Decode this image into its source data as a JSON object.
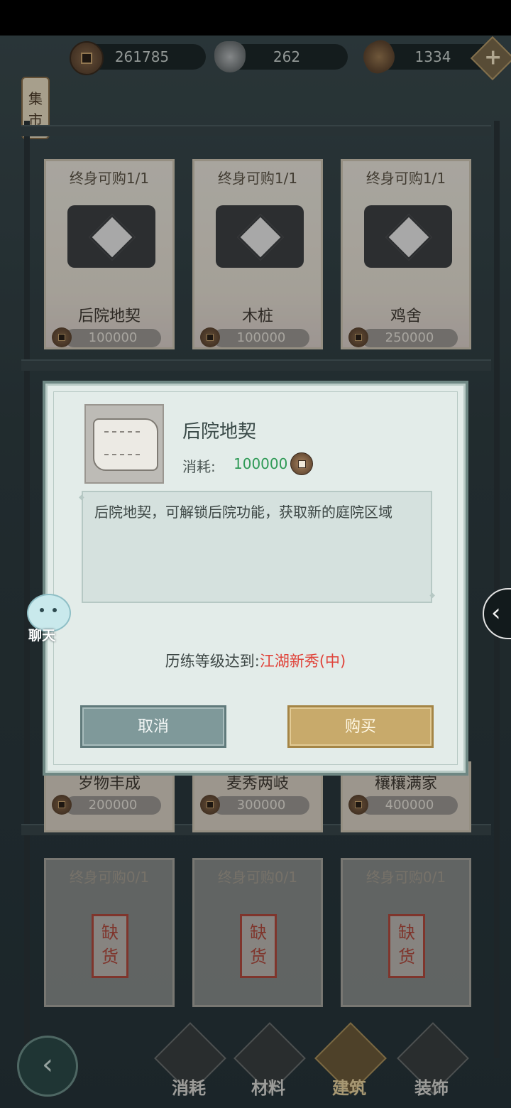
{
  "currencies": [
    {
      "icon": "copper-coin-icon",
      "value": "261785"
    },
    {
      "icon": "silver-ingot-icon",
      "value": "262"
    },
    {
      "icon": "seed-icon",
      "value": "1334"
    }
  ],
  "add_currency_icon": "plus-icon",
  "market_tag": "集市",
  "shelf_items": [
    {
      "limit": "终身可购1/1",
      "name": "后院地契",
      "price": "100000"
    },
    {
      "limit": "终身可购1/1",
      "name": "木桩",
      "price": "100000"
    },
    {
      "limit": "终身可购1/1",
      "name": "鸡舍",
      "price": "250000"
    }
  ],
  "shelf_items_row3": [
    {
      "name": "岁物丰成",
      "price": "200000"
    },
    {
      "name": "麦秀两岐",
      "price": "300000"
    },
    {
      "name": "穰穰满家",
      "price": "400000"
    }
  ],
  "shelf_items_soldout": [
    {
      "limit": "终身可购0/1",
      "stamp": "缺货"
    },
    {
      "limit": "终身可购0/1",
      "stamp": "缺货"
    },
    {
      "limit": "终身可购0/1",
      "stamp": "缺货"
    }
  ],
  "dialog": {
    "item_name": "后院地契",
    "cost_label": "消耗:",
    "cost_value": "100000",
    "description": "后院地契，可解锁后院功能，获取新的庭院区域",
    "requirement_label": "历练等级达到:",
    "requirement_value": "江湖新秀(中)",
    "cancel_label": "取消",
    "buy_label": "购买"
  },
  "chat_label": "聊天",
  "bottom_nav": [
    {
      "label": "消耗",
      "active": false
    },
    {
      "label": "材料",
      "active": false
    },
    {
      "label": "建筑",
      "active": true
    },
    {
      "label": "装饰",
      "active": false
    }
  ],
  "colors": {
    "cost_green": "#2f9a56",
    "requirement_red": "#e0453c",
    "buy_gold": "#c8aa6b",
    "cancel_teal": "#7f999a"
  }
}
